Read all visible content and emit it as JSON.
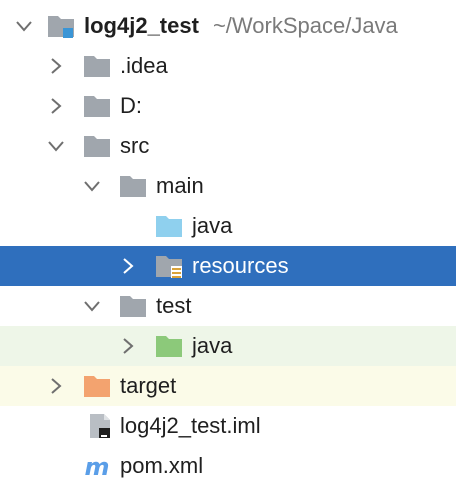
{
  "project": {
    "name": "log4j2_test",
    "path": "~/WorkSpace/Java"
  },
  "tree": {
    "idea": {
      "label": ".idea",
      "icon": "folder-icon"
    },
    "d": {
      "label": "D:",
      "icon": "folder-icon"
    },
    "src": {
      "label": "src",
      "icon": "folder-icon"
    },
    "main": {
      "label": "main",
      "icon": "folder-icon"
    },
    "main_java": {
      "label": "java",
      "icon": "source-folder-icon"
    },
    "resources": {
      "label": "resources",
      "icon": "resources-folder-icon"
    },
    "test": {
      "label": "test",
      "icon": "folder-icon"
    },
    "test_java": {
      "label": "java",
      "icon": "test-source-folder-icon"
    },
    "target": {
      "label": "target",
      "icon": "excluded-folder-icon"
    },
    "iml": {
      "label": "log4j2_test.iml",
      "icon": "iml-file-icon"
    },
    "pom": {
      "label": "pom.xml",
      "icon": "maven-icon"
    }
  },
  "colors": {
    "selection": "#2f6fbd",
    "test_row": "#eef6e8",
    "excluded_row": "#fbfbe8",
    "folder": "#a0a6ad",
    "source_folder": "#8fd0ee",
    "test_folder": "#8cc97a",
    "excluded_folder": "#f3a36f",
    "maven": "#5a9ee8"
  }
}
